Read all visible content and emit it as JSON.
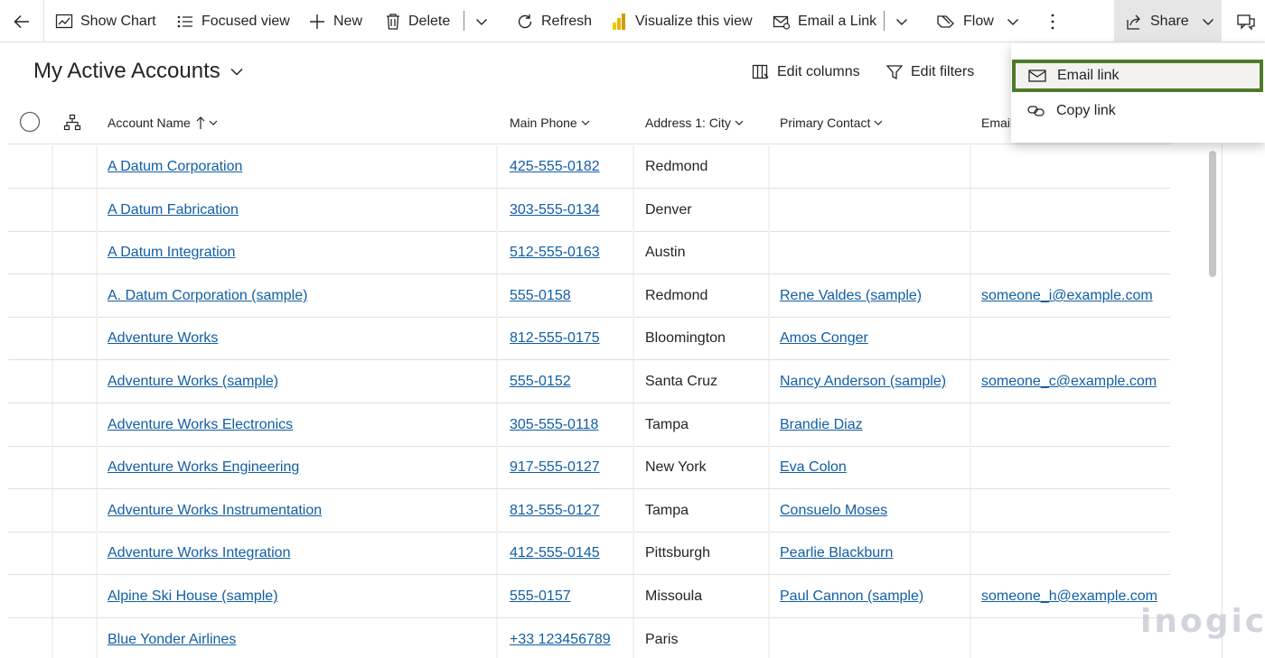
{
  "command_bar": {
    "show_chart": "Show Chart",
    "focused_view": "Focused view",
    "new": "New",
    "delete": "Delete",
    "refresh": "Refresh",
    "visualize": "Visualize this view",
    "email_a_link": "Email a Link",
    "flow": "Flow",
    "share": "Share"
  },
  "view": {
    "title": "My Active Accounts",
    "edit_columns": "Edit columns",
    "edit_filters": "Edit filters"
  },
  "grid": {
    "columns": {
      "account_name": "Account Name",
      "main_phone": "Main Phone",
      "city": "Address 1: City",
      "primary_contact": "Primary Contact",
      "email": "Email"
    },
    "rows": [
      {
        "name": "A Datum Corporation",
        "phone": "425-555-0182",
        "city": "Redmond",
        "contact": "",
        "email": ""
      },
      {
        "name": "A Datum Fabrication",
        "phone": "303-555-0134",
        "city": "Denver",
        "contact": "",
        "email": ""
      },
      {
        "name": "A Datum Integration",
        "phone": "512-555-0163",
        "city": "Austin",
        "contact": "",
        "email": ""
      },
      {
        "name": "A. Datum Corporation (sample)",
        "phone": "555-0158",
        "city": "Redmond",
        "contact": "Rene Valdes (sample)",
        "email": "someone_i@example.com"
      },
      {
        "name": "Adventure Works",
        "phone": "812-555-0175",
        "city": "Bloomington",
        "contact": "Amos Conger",
        "email": ""
      },
      {
        "name": "Adventure Works (sample)",
        "phone": "555-0152",
        "city": "Santa Cruz",
        "contact": "Nancy Anderson (sample)",
        "email": "someone_c@example.com"
      },
      {
        "name": "Adventure Works Electronics",
        "phone": "305-555-0118",
        "city": "Tampa",
        "contact": "Brandie Diaz",
        "email": ""
      },
      {
        "name": "Adventure Works Engineering",
        "phone": "917-555-0127",
        "city": "New York",
        "contact": "Eva Colon",
        "email": ""
      },
      {
        "name": "Adventure Works Instrumentation",
        "phone": "813-555-0127",
        "city": "Tampa",
        "contact": "Consuelo Moses",
        "email": ""
      },
      {
        "name": "Adventure Works Integration",
        "phone": "412-555-0145",
        "city": "Pittsburgh",
        "contact": "Pearlie Blackburn",
        "email": ""
      },
      {
        "name": "Alpine Ski House (sample)",
        "phone": "555-0157",
        "city": "Missoula",
        "contact": "Paul Cannon (sample)",
        "email": "someone_h@example.com"
      },
      {
        "name": "Blue Yonder Airlines",
        "phone": "+33 123456789",
        "city": "Paris",
        "contact": "",
        "email": ""
      }
    ]
  },
  "share_menu": {
    "email_link": "Email link",
    "copy_link": "Copy link"
  },
  "watermark": "inogic",
  "colors": {
    "link": "#115ea3",
    "highlight_border": "#4f7a28",
    "share_active_bg": "#e6e6e6"
  }
}
